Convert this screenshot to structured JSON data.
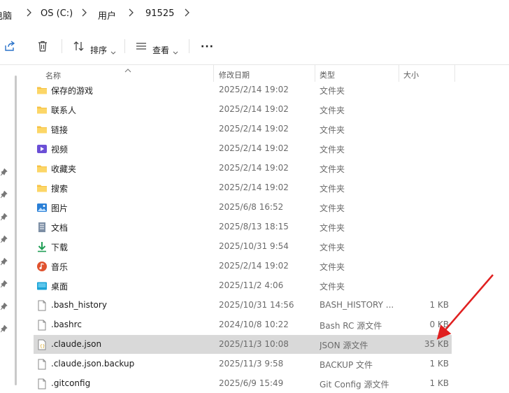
{
  "breadcrumb": {
    "items": [
      "电脑",
      "OS (C:)",
      "用户",
      "91525"
    ]
  },
  "toolbar": {
    "share_icon": "share-icon",
    "delete_icon": "trash-icon",
    "sort_label": "排序",
    "view_label": "查看",
    "more_label": "···"
  },
  "columns": {
    "name": "名称",
    "date": "修改日期",
    "type": "类型",
    "size": "大小"
  },
  "files": [
    {
      "name": "保存的游戏",
      "date": "2025/2/14 19:02",
      "type": "文件夹",
      "size": "",
      "icon": "folder-icon"
    },
    {
      "name": "联系人",
      "date": "2025/2/14 19:02",
      "type": "文件夹",
      "size": "",
      "icon": "folder-icon"
    },
    {
      "name": "链接",
      "date": "2025/2/14 19:02",
      "type": "文件夹",
      "size": "",
      "icon": "folder-icon"
    },
    {
      "name": "视频",
      "date": "2025/2/14 19:02",
      "type": "文件夹",
      "size": "",
      "icon": "videos-folder-icon"
    },
    {
      "name": "收藏夹",
      "date": "2025/2/14 19:02",
      "type": "文件夹",
      "size": "",
      "icon": "folder-icon"
    },
    {
      "name": "搜索",
      "date": "2025/2/14 19:02",
      "type": "文件夹",
      "size": "",
      "icon": "folder-icon"
    },
    {
      "name": "图片",
      "date": "2025/6/8 16:52",
      "type": "文件夹",
      "size": "",
      "icon": "pictures-folder-icon"
    },
    {
      "name": "文档",
      "date": "2025/8/13 18:15",
      "type": "文件夹",
      "size": "",
      "icon": "documents-folder-icon"
    },
    {
      "name": "下载",
      "date": "2025/10/31 9:54",
      "type": "文件夹",
      "size": "",
      "icon": "downloads-folder-icon"
    },
    {
      "name": "音乐",
      "date": "2025/2/14 19:02",
      "type": "文件夹",
      "size": "",
      "icon": "music-folder-icon"
    },
    {
      "name": "桌面",
      "date": "2025/11/2 4:06",
      "type": "文件夹",
      "size": "",
      "icon": "desktop-folder-icon"
    },
    {
      "name": ".bash_history",
      "date": "2025/10/31 14:56",
      "type": "BASH_HISTORY ...",
      "size": "1 KB",
      "icon": "file-icon"
    },
    {
      "name": ".bashrc",
      "date": "2024/10/8 10:22",
      "type": "Bash RC 源文件",
      "size": "0 KB",
      "icon": "file-icon"
    },
    {
      "name": ".claude.json",
      "date": "2025/11/3 10:08",
      "type": "JSON 源文件",
      "size": "35 KB",
      "icon": "json-file-icon"
    },
    {
      "name": ".claude.json.backup",
      "date": "2025/11/3 9:58",
      "type": "BACKUP 文件",
      "size": "1 KB",
      "icon": "file-icon"
    },
    {
      "name": ".gitconfig",
      "date": "2025/6/9 15:49",
      "type": "Git Config 源文件",
      "size": "1 KB",
      "icon": "file-icon"
    }
  ],
  "selected_row": ".claude.json",
  "colors": {
    "selection": "#d9d9d9",
    "annotation_arrow": "#e02020",
    "folder": "#f6c244"
  }
}
